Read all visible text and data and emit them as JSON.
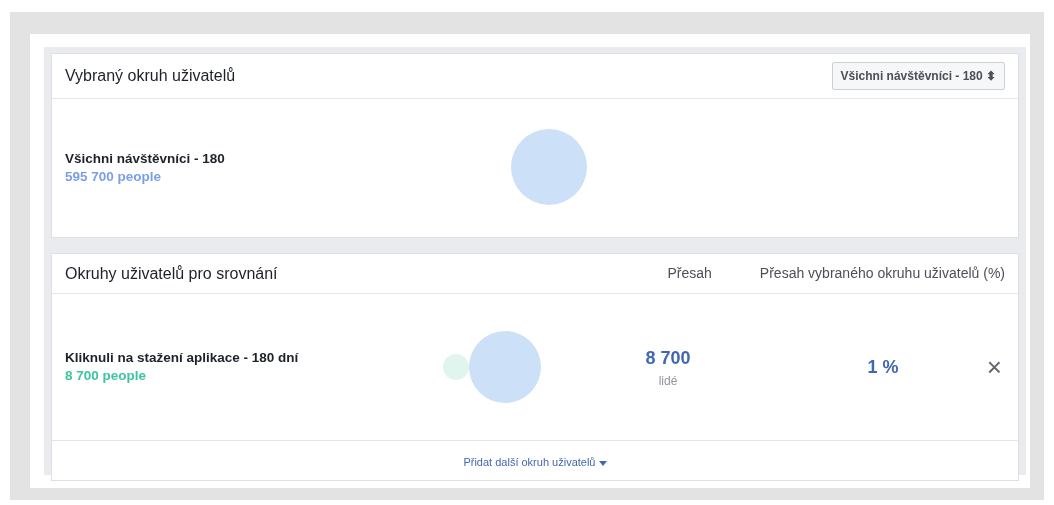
{
  "selected_audience": {
    "title": "Vybraný okruh uživatelů",
    "dropdown": {
      "value": "Všichni návštěvníci - 180",
      "arrow": "⬍"
    },
    "name": "Všichni návštěvníci - 180",
    "people": "595 700 people",
    "color": "#7b9ee8"
  },
  "comparison": {
    "title": "Okruhy uživatelů pro srovnání",
    "columns": [
      "Přesah",
      "Přesah vybraného okruhu uživatelů (%)"
    ],
    "rows": [
      {
        "name": "Kliknuli na stažení aplikace - 180 dní",
        "people": "8 700 people",
        "color": "#3cc5a0",
        "overlap": "8 700",
        "overlap_unit": "lidé",
        "percent": "1 %",
        "remove": "×"
      }
    ],
    "add_link": "Přidat další okruh uživatelů"
  }
}
